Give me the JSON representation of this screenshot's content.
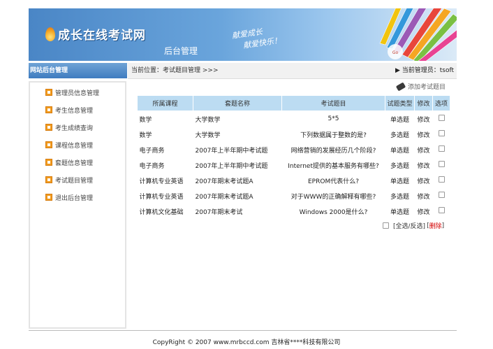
{
  "header": {
    "site_name": "成长在线考试网",
    "subtitle": "后台管理",
    "slogan_line1": "献爱成长",
    "slogan_line2": "献爱快乐！"
  },
  "sidebar": {
    "title": "网站后台管理",
    "items": [
      {
        "label": "管理员信息管理"
      },
      {
        "label": "考生信息管理"
      },
      {
        "label": "考生成绩查询"
      },
      {
        "label": "课程信息管理"
      },
      {
        "label": "套题信息管理"
      },
      {
        "label": "考试题目管理"
      },
      {
        "label": "退出后台管理"
      }
    ]
  },
  "breadcrumb": {
    "location": "当前位置：考试题目管理 >>>",
    "admin": "当前管理员：tsoft"
  },
  "toolbar": {
    "add_label": "添加考试题目"
  },
  "table": {
    "headers": [
      "所属课程",
      "套题名称",
      "考试题目",
      "试题类型",
      "修改",
      "选项"
    ],
    "rows": [
      {
        "course": "数学",
        "set": "大学数学",
        "question": "5*5",
        "type": "单选题",
        "edit": "修改"
      },
      {
        "course": "数学",
        "set": "大学数学",
        "question": "下列数据属于整数的是?",
        "type": "多选题",
        "edit": "修改"
      },
      {
        "course": "电子商务",
        "set": "2007年上半年期中考试题",
        "question": "网络营销的发展经历几个阶段?",
        "type": "单选题",
        "edit": "修改"
      },
      {
        "course": "电子商务",
        "set": "2007年上半年期中考试题",
        "question": "Internet提供的基本服务有哪些?",
        "type": "多选题",
        "edit": "修改"
      },
      {
        "course": "计算机专业英语",
        "set": "2007年期末考试题A",
        "question": "EPROM代表什么?",
        "type": "单选题",
        "edit": "修改"
      },
      {
        "course": "计算机专业英语",
        "set": "2007年期末考试题A",
        "question": "对于WWW的正确解释有哪些?",
        "type": "多选题",
        "edit": "修改"
      },
      {
        "course": "计算机文化基础",
        "set": "2007年期末考试",
        "question": "Windows 2000是什么?",
        "type": "单选题",
        "edit": "修改"
      }
    ]
  },
  "bulk": {
    "select_label": "[全选/反选]",
    "delete_open": "[",
    "delete_label": "删除",
    "delete_close": "]"
  },
  "footer": {
    "text": "CopyRight © 2007 www.mrbccd.com 吉林省****科技有限公司"
  },
  "colors": {
    "accent": "#3f7cc0",
    "header_bg": "#bcdcf2",
    "icon": "#f29c1f",
    "delete": "#d40000"
  }
}
